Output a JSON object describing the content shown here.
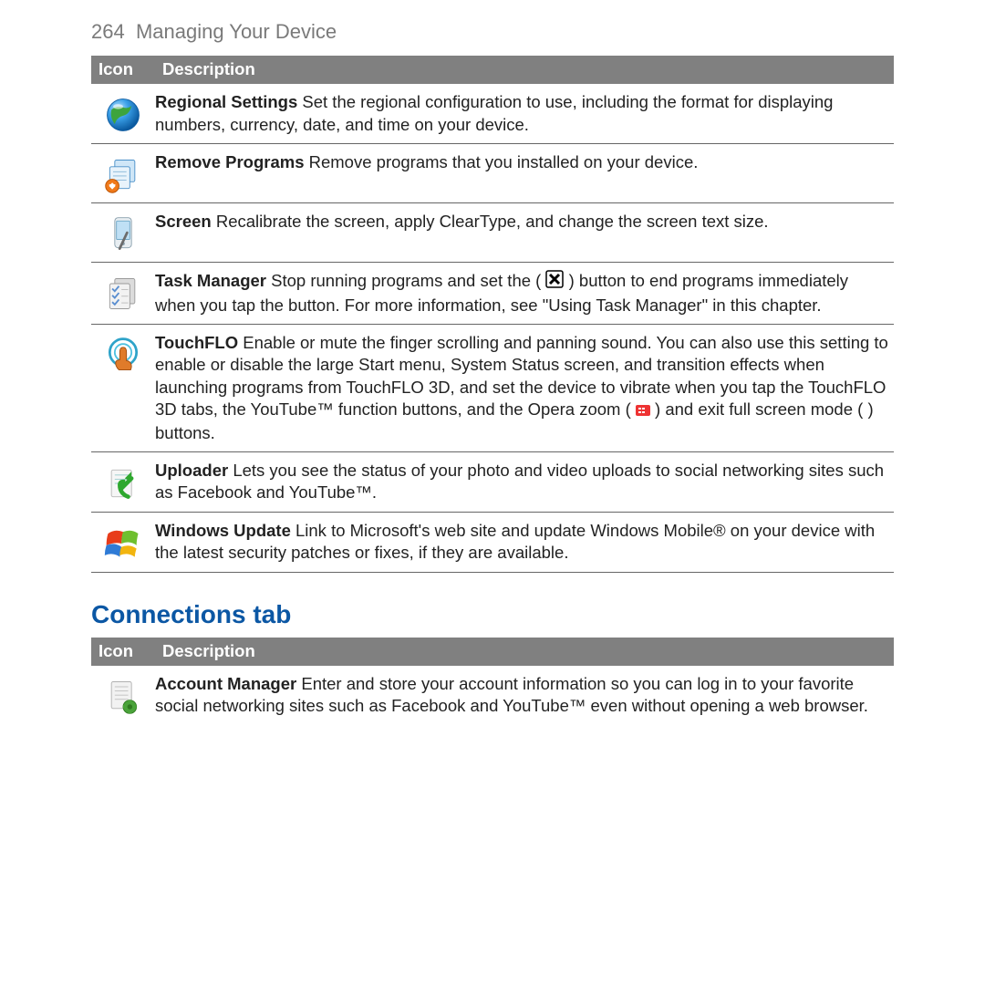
{
  "page": {
    "number": "264",
    "title": "Managing Your Device"
  },
  "table1": {
    "header_icon": "Icon",
    "header_desc": "Description",
    "rows": [
      {
        "icon": "globe-icon",
        "title": "Regional Settings",
        "text": "  Set the regional configuration to use, including the format for displaying numbers, currency, date, and time on your device."
      },
      {
        "icon": "remove-programs-icon",
        "title": "Remove Programs",
        "text": "  Remove programs that you installed on your device."
      },
      {
        "icon": "screen-icon",
        "title": "Screen",
        "text": "  Recalibrate the screen, apply ClearType, and change the screen text size."
      },
      {
        "icon": "task-manager-icon",
        "title": "Task Manager",
        "text_a": "  Stop running programs and set the ( ",
        "text_b": " ) button to end programs immediately when you tap the button. For more information, see \"Using Task Manager\" in this chapter."
      },
      {
        "icon": "touchflo-icon",
        "title": "TouchFLO",
        "text_a": "  Enable or mute the finger scrolling and panning sound. You can also use this setting to enable or disable the large Start menu, System Status screen, and transition effects when launching programs from TouchFLO 3D, and set the device to vibrate when you tap the TouchFLO 3D tabs, the YouTube™ function buttons, and the Opera zoom ( ",
        "text_b": " ) and exit full screen mode (        ) buttons."
      },
      {
        "icon": "uploader-icon",
        "title": "Uploader",
        "text": "  Lets you see the status of your photo and video uploads to social networking sites such as Facebook and YouTube™."
      },
      {
        "icon": "windows-update-icon",
        "title": "Windows Update",
        "text": "  Link to Microsoft's web site and update Windows Mobile® on your device with the latest security patches or fixes, if they are available."
      }
    ]
  },
  "section2_title": "Connections tab",
  "table2": {
    "header_icon": "Icon",
    "header_desc": "Description",
    "rows": [
      {
        "icon": "account-manager-icon",
        "title": "Account Manager",
        "text": "  Enter and store your account information so you can log in to your favorite social networking sites such as Facebook and YouTube™ even without opening a web browser."
      }
    ]
  }
}
